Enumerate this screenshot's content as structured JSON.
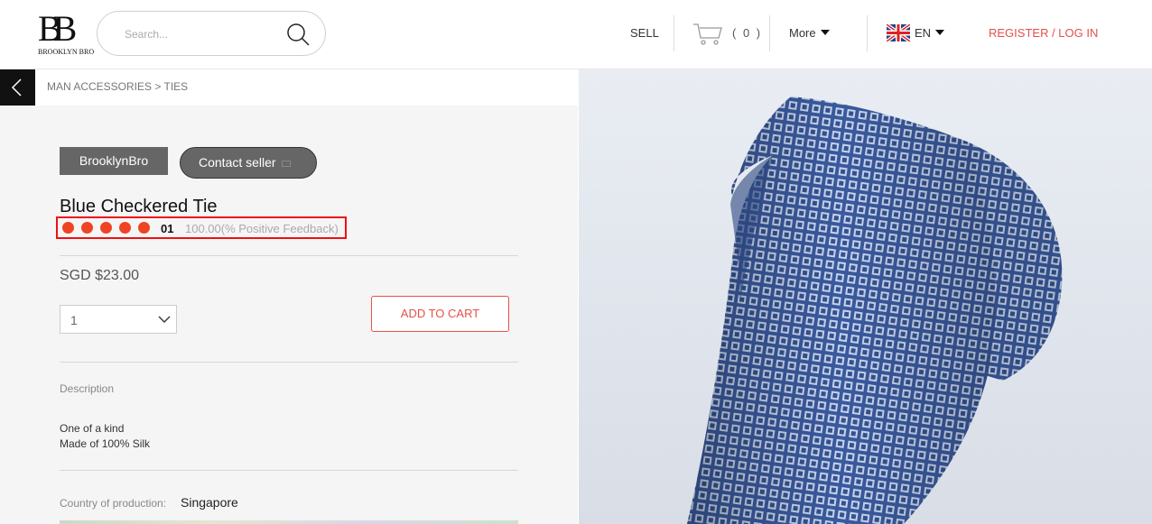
{
  "header": {
    "logo_mark": "BB",
    "logo_text": "BROOKLYN BRO",
    "search_placeholder": "Search...",
    "sell_label": "SELL",
    "cart_count": "( 0 )",
    "more_label": "More",
    "language": "EN",
    "login_label": "REGISTER / LOG IN",
    "accent_color": "#e5504a"
  },
  "breadcrumb": "MAN ACCESSORIES > TIES",
  "product": {
    "seller": "BrooklynBro",
    "contact_label": "Contact seller",
    "title": "Blue Checkered Tie",
    "rating_count": "01",
    "rating_text": "100.00(% Positive Feedback)",
    "rating_stars": 5,
    "price": "SGD $23.00",
    "quantity": "1",
    "add_to_cart": "ADD TO CART",
    "description_label": "Description",
    "description_lines": [
      "One of a kind",
      "Made of 100% Silk"
    ],
    "country_label": "Country of production:",
    "country": "Singapore"
  },
  "image": {
    "tie_color": "#3a5a9e"
  }
}
